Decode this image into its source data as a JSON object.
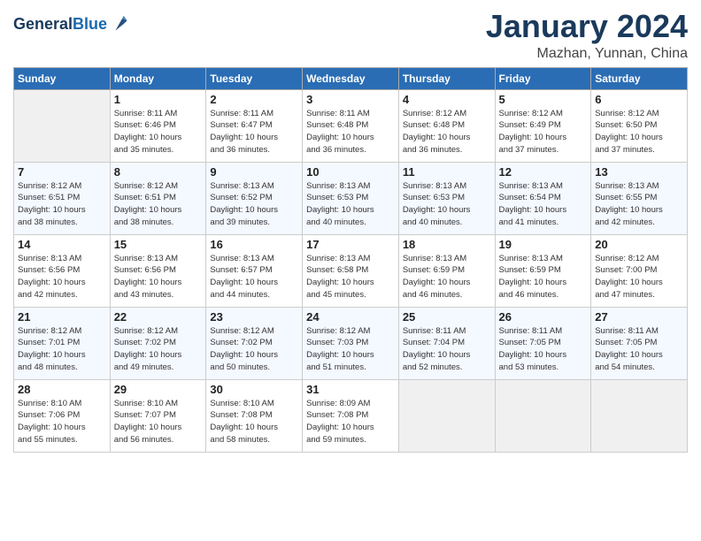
{
  "header": {
    "logo_line1": "General",
    "logo_line2": "Blue",
    "month": "January 2024",
    "location": "Mazhan, Yunnan, China"
  },
  "columns": [
    "Sunday",
    "Monday",
    "Tuesday",
    "Wednesday",
    "Thursday",
    "Friday",
    "Saturday"
  ],
  "weeks": [
    {
      "days": [
        {
          "num": "",
          "info": ""
        },
        {
          "num": "1",
          "info": "Sunrise: 8:11 AM\nSunset: 6:46 PM\nDaylight: 10 hours\nand 35 minutes."
        },
        {
          "num": "2",
          "info": "Sunrise: 8:11 AM\nSunset: 6:47 PM\nDaylight: 10 hours\nand 36 minutes."
        },
        {
          "num": "3",
          "info": "Sunrise: 8:11 AM\nSunset: 6:48 PM\nDaylight: 10 hours\nand 36 minutes."
        },
        {
          "num": "4",
          "info": "Sunrise: 8:12 AM\nSunset: 6:48 PM\nDaylight: 10 hours\nand 36 minutes."
        },
        {
          "num": "5",
          "info": "Sunrise: 8:12 AM\nSunset: 6:49 PM\nDaylight: 10 hours\nand 37 minutes."
        },
        {
          "num": "6",
          "info": "Sunrise: 8:12 AM\nSunset: 6:50 PM\nDaylight: 10 hours\nand 37 minutes."
        }
      ]
    },
    {
      "days": [
        {
          "num": "7",
          "info": "Sunrise: 8:12 AM\nSunset: 6:51 PM\nDaylight: 10 hours\nand 38 minutes."
        },
        {
          "num": "8",
          "info": "Sunrise: 8:12 AM\nSunset: 6:51 PM\nDaylight: 10 hours\nand 38 minutes."
        },
        {
          "num": "9",
          "info": "Sunrise: 8:13 AM\nSunset: 6:52 PM\nDaylight: 10 hours\nand 39 minutes."
        },
        {
          "num": "10",
          "info": "Sunrise: 8:13 AM\nSunset: 6:53 PM\nDaylight: 10 hours\nand 40 minutes."
        },
        {
          "num": "11",
          "info": "Sunrise: 8:13 AM\nSunset: 6:53 PM\nDaylight: 10 hours\nand 40 minutes."
        },
        {
          "num": "12",
          "info": "Sunrise: 8:13 AM\nSunset: 6:54 PM\nDaylight: 10 hours\nand 41 minutes."
        },
        {
          "num": "13",
          "info": "Sunrise: 8:13 AM\nSunset: 6:55 PM\nDaylight: 10 hours\nand 42 minutes."
        }
      ]
    },
    {
      "days": [
        {
          "num": "14",
          "info": "Sunrise: 8:13 AM\nSunset: 6:56 PM\nDaylight: 10 hours\nand 42 minutes."
        },
        {
          "num": "15",
          "info": "Sunrise: 8:13 AM\nSunset: 6:56 PM\nDaylight: 10 hours\nand 43 minutes."
        },
        {
          "num": "16",
          "info": "Sunrise: 8:13 AM\nSunset: 6:57 PM\nDaylight: 10 hours\nand 44 minutes."
        },
        {
          "num": "17",
          "info": "Sunrise: 8:13 AM\nSunset: 6:58 PM\nDaylight: 10 hours\nand 45 minutes."
        },
        {
          "num": "18",
          "info": "Sunrise: 8:13 AM\nSunset: 6:59 PM\nDaylight: 10 hours\nand 46 minutes."
        },
        {
          "num": "19",
          "info": "Sunrise: 8:13 AM\nSunset: 6:59 PM\nDaylight: 10 hours\nand 46 minutes."
        },
        {
          "num": "20",
          "info": "Sunrise: 8:12 AM\nSunset: 7:00 PM\nDaylight: 10 hours\nand 47 minutes."
        }
      ]
    },
    {
      "days": [
        {
          "num": "21",
          "info": "Sunrise: 8:12 AM\nSunset: 7:01 PM\nDaylight: 10 hours\nand 48 minutes."
        },
        {
          "num": "22",
          "info": "Sunrise: 8:12 AM\nSunset: 7:02 PM\nDaylight: 10 hours\nand 49 minutes."
        },
        {
          "num": "23",
          "info": "Sunrise: 8:12 AM\nSunset: 7:02 PM\nDaylight: 10 hours\nand 50 minutes."
        },
        {
          "num": "24",
          "info": "Sunrise: 8:12 AM\nSunset: 7:03 PM\nDaylight: 10 hours\nand 51 minutes."
        },
        {
          "num": "25",
          "info": "Sunrise: 8:11 AM\nSunset: 7:04 PM\nDaylight: 10 hours\nand 52 minutes."
        },
        {
          "num": "26",
          "info": "Sunrise: 8:11 AM\nSunset: 7:05 PM\nDaylight: 10 hours\nand 53 minutes."
        },
        {
          "num": "27",
          "info": "Sunrise: 8:11 AM\nSunset: 7:05 PM\nDaylight: 10 hours\nand 54 minutes."
        }
      ]
    },
    {
      "days": [
        {
          "num": "28",
          "info": "Sunrise: 8:10 AM\nSunset: 7:06 PM\nDaylight: 10 hours\nand 55 minutes."
        },
        {
          "num": "29",
          "info": "Sunrise: 8:10 AM\nSunset: 7:07 PM\nDaylight: 10 hours\nand 56 minutes."
        },
        {
          "num": "30",
          "info": "Sunrise: 8:10 AM\nSunset: 7:08 PM\nDaylight: 10 hours\nand 58 minutes."
        },
        {
          "num": "31",
          "info": "Sunrise: 8:09 AM\nSunset: 7:08 PM\nDaylight: 10 hours\nand 59 minutes."
        },
        {
          "num": "",
          "info": ""
        },
        {
          "num": "",
          "info": ""
        },
        {
          "num": "",
          "info": ""
        }
      ]
    }
  ]
}
